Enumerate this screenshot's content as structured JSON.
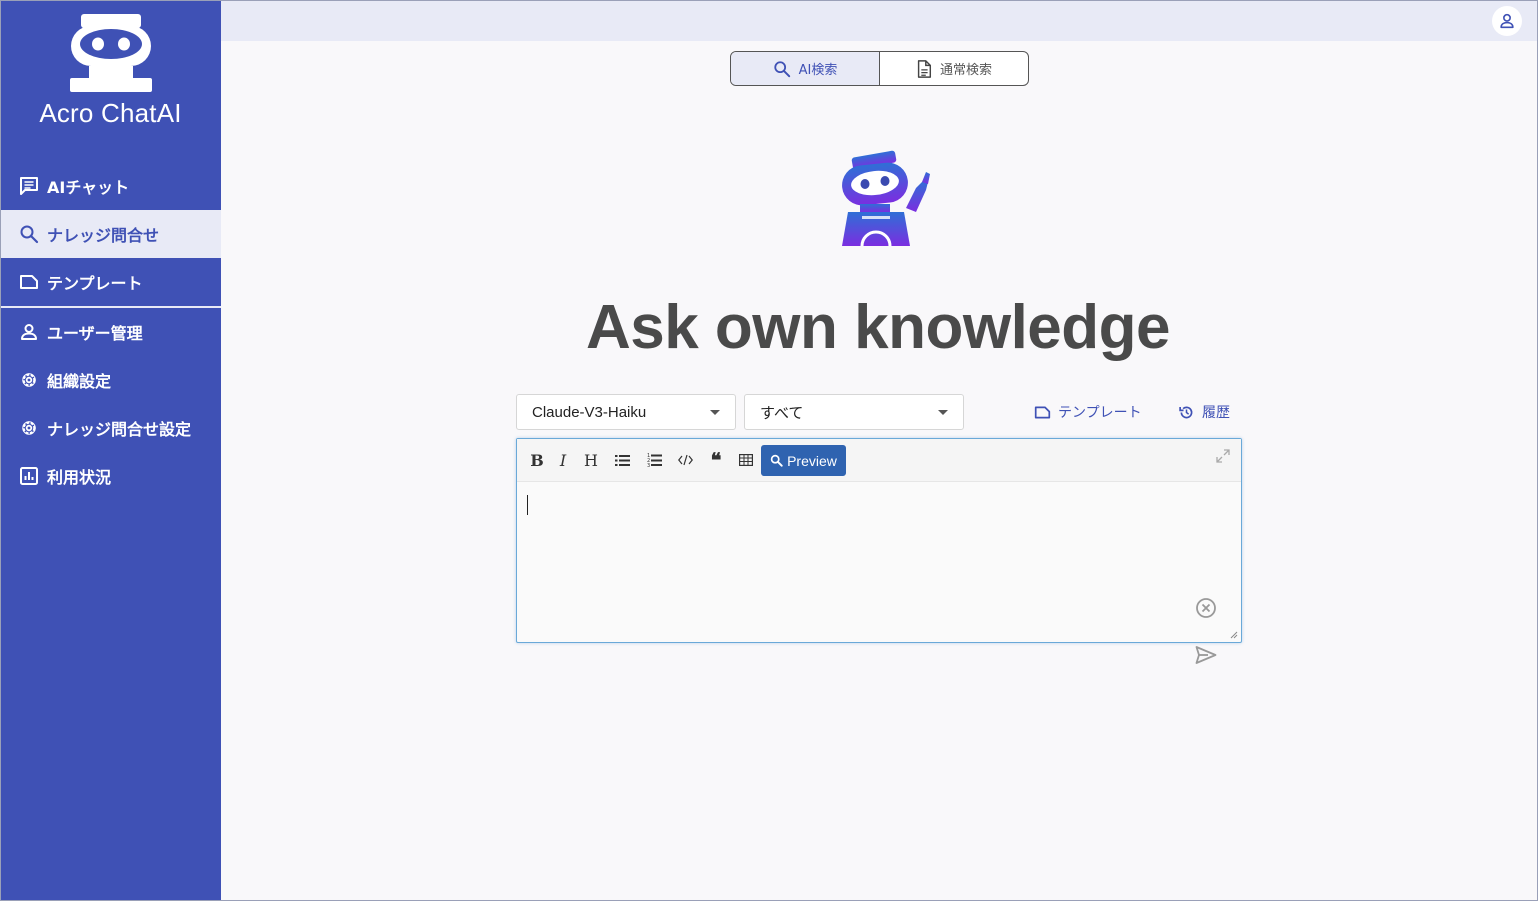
{
  "app": {
    "name": "Acro ChatAI"
  },
  "sidebar": {
    "items": [
      {
        "label": "AIチャット",
        "icon": "chat-icon"
      },
      {
        "label": "ナレッジ問合せ",
        "icon": "search-icon",
        "active": true
      },
      {
        "label": "テンプレート",
        "icon": "template-icon"
      },
      {
        "label": "ユーザー管理",
        "icon": "user-icon"
      },
      {
        "label": "組織設定",
        "icon": "gear-icon"
      },
      {
        "label": "ナレッジ問合せ設定",
        "icon": "gear-icon"
      },
      {
        "label": "利用状況",
        "icon": "chart-icon"
      }
    ]
  },
  "header": {
    "user_icon": "account-icon"
  },
  "mode_toggle": {
    "ai_search": "AI検索",
    "normal_search": "通常検索",
    "selected": "AI検索"
  },
  "main": {
    "title": "Ask own knowledge"
  },
  "controls": {
    "model": "Claude-V3-Haiku",
    "scope": "すべて",
    "template_label": "テンプレート",
    "history_label": "履歴"
  },
  "editor": {
    "toolbar": {
      "bold": "B",
      "italic": "I",
      "heading": "H",
      "quote": "❝",
      "preview": "Preview"
    },
    "value": ""
  },
  "colors": {
    "primary": "#3f51b5",
    "active_bg": "#e8eaf6",
    "preview": "#2f63b0",
    "title": "#4a4a4a"
  }
}
